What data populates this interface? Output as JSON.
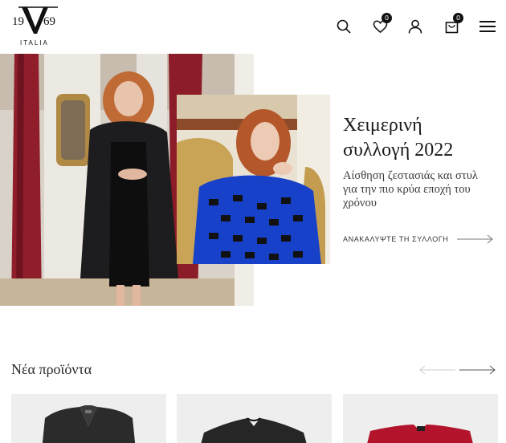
{
  "brand": {
    "logo_top_left": "19",
    "logo_top_right": "69",
    "logo_sub": "ITALIA"
  },
  "header": {
    "wishlist_count": "0",
    "cart_count": "0",
    "icons": [
      "search-icon",
      "heart-icon",
      "user-icon",
      "shopping-bag-icon",
      "menu-icon"
    ]
  },
  "hero": {
    "title_line1": "Χειμερινή",
    "title_line2": "συλλογή 2022",
    "subtitle_line1": "Αίσθηση ζεστασιάς και στυλ",
    "subtitle_line2": "για την πιο κρύα εποχή του",
    "subtitle_line3": "χρόνου",
    "cta_label": "ΑΝΑΚΑΛΥΨΤΕ ΤΗ ΣΥΛΛΟΓΗ"
  },
  "new_products": {
    "title": "Νέα προϊόντα",
    "items": [
      {
        "color": "#2b2b2b"
      },
      {
        "color": "#262626"
      },
      {
        "color": "#b3142b"
      }
    ]
  },
  "colors": {
    "accent": "#111111",
    "arrow_inactive": "#cccccc",
    "arrow_active": "#555555"
  }
}
